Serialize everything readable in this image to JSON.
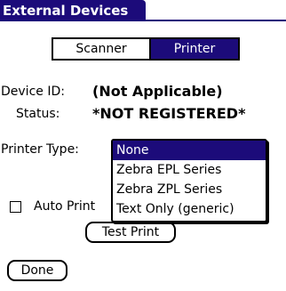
{
  "colors": {
    "accent": "#1c0b7a",
    "selected_text": "#ffffff"
  },
  "header": {
    "title": "External Devices"
  },
  "tabs": [
    {
      "label": "Scanner",
      "selected": false
    },
    {
      "label": "Printer",
      "selected": true
    }
  ],
  "device": {
    "id_label": "Device ID:",
    "id_value": "(Not Applicable)",
    "status_label": "Status:",
    "status_value": "*NOT REGISTERED*"
  },
  "printer_type": {
    "label": "Printer Type:",
    "options": [
      "None",
      "Zebra EPL Series",
      "Zebra ZPL Series",
      "Text Only (generic)"
    ],
    "selected": "None"
  },
  "auto_print": {
    "label": "Auto Print",
    "checked": false
  },
  "buttons": {
    "test_print": "Test Print",
    "done": "Done"
  }
}
